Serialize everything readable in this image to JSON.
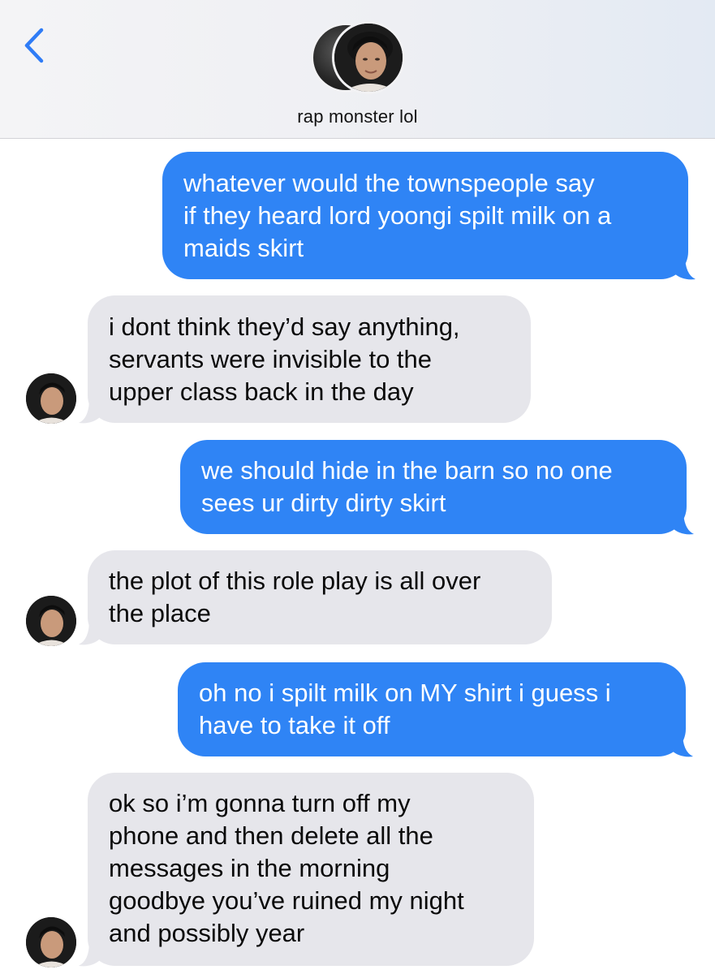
{
  "header": {
    "contact_name": "rap monster lol"
  },
  "messages": [
    {
      "direction": "outgoing",
      "lines": [
        "whatever would the townspeople say",
        "if they heard lord yoongi spilt milk on a",
        "maids skirt"
      ]
    },
    {
      "direction": "incoming",
      "lines": [
        "i dont think they’d say anything,",
        "servants were invisible to the",
        "upper class back in the day"
      ]
    },
    {
      "direction": "outgoing",
      "lines": [
        "we should hide in the barn so no one",
        "sees ur dirty dirty skirt"
      ]
    },
    {
      "direction": "incoming",
      "lines": [
        "the plot of this role play is all over",
        "the place"
      ]
    },
    {
      "direction": "outgoing",
      "lines": [
        "oh no i spilt milk on MY shirt i guess i",
        "have to take it off"
      ]
    },
    {
      "direction": "incoming",
      "lines": [
        "ok so i’m gonna turn off my",
        "phone and then delete all the",
        "messages in the morning",
        "goodbye you’ve ruined my night",
        "and possibly year"
      ]
    }
  ],
  "colors": {
    "outgoing_bubble": "#2f84f5",
    "incoming_bubble": "#e6e6eb",
    "back_chevron": "#2f7cf6"
  }
}
